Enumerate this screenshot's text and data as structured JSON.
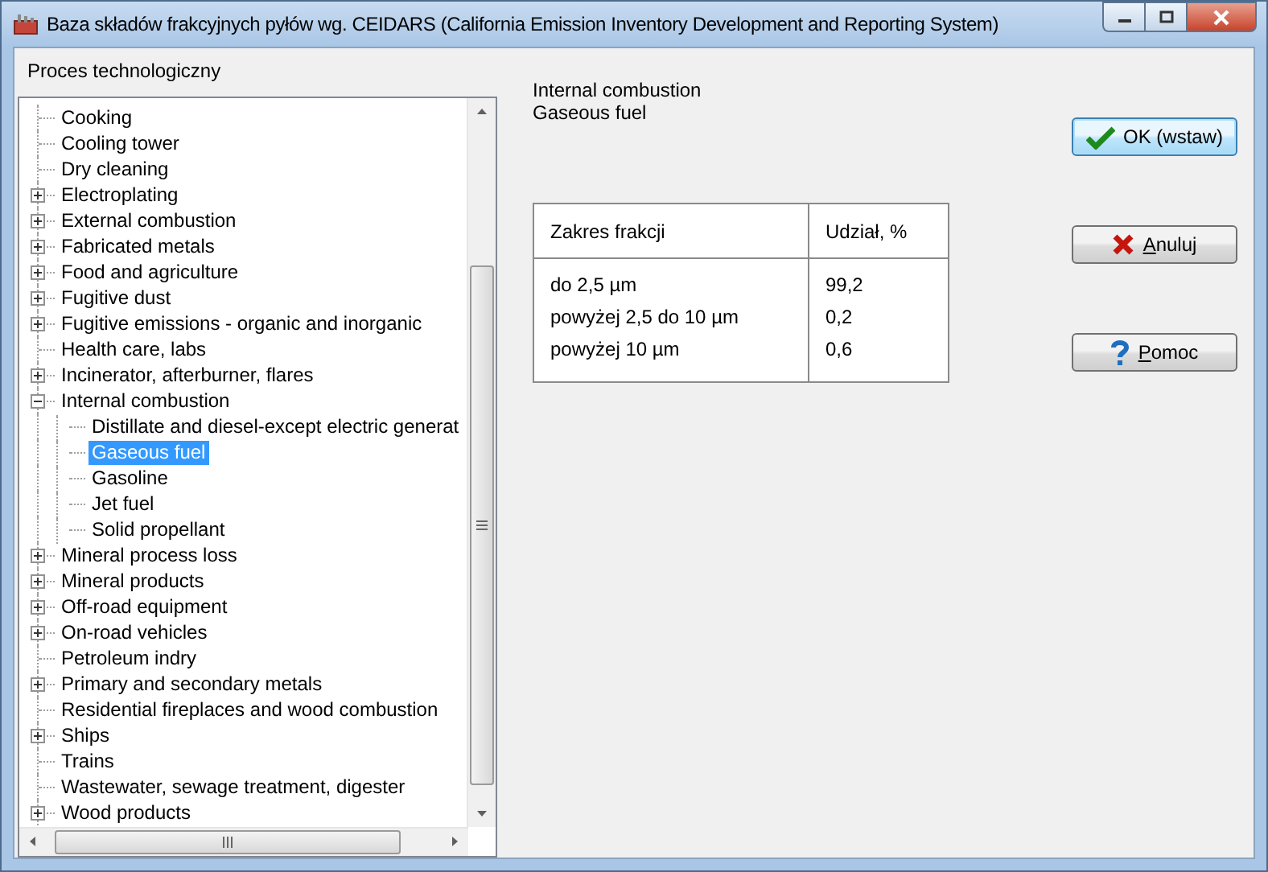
{
  "window": {
    "title": "Baza składów frakcyjnych pyłów wg. CEIDARS (California Emission Inventory Development and Reporting System)"
  },
  "tree": {
    "label": "Proces technologiczny",
    "items": [
      {
        "label": "Cooking",
        "selected": false
      },
      {
        "label": "Cooling tower",
        "selected": false
      },
      {
        "label": "Dry cleaning",
        "selected": false
      },
      {
        "label": "Electroplating",
        "expanded": false,
        "selected": false
      },
      {
        "label": "External combustion",
        "expanded": false,
        "selected": false
      },
      {
        "label": "Fabricated metals",
        "expanded": false,
        "selected": false
      },
      {
        "label": "Food and agriculture",
        "expanded": false,
        "selected": false
      },
      {
        "label": "Fugitive dust",
        "expanded": false,
        "selected": false
      },
      {
        "label": "Fugitive emissions - organic and inorganic",
        "expanded": false,
        "selected": false
      },
      {
        "label": "Health care, labs",
        "selected": false
      },
      {
        "label": "Incinerator, afterburner, flares",
        "expanded": false,
        "selected": false
      },
      {
        "label": "Internal combustion",
        "expanded": true,
        "selected": false,
        "children": [
          {
            "label": "Distillate and diesel-except electric generat",
            "selected": false
          },
          {
            "label": "Gaseous fuel",
            "selected": true
          },
          {
            "label": "Gasoline",
            "selected": false
          },
          {
            "label": "Jet fuel",
            "selected": false
          },
          {
            "label": "Solid propellant",
            "selected": false
          }
        ]
      },
      {
        "label": "Mineral process loss",
        "expanded": false,
        "selected": false
      },
      {
        "label": "Mineral products",
        "expanded": false,
        "selected": false
      },
      {
        "label": "Off-road equipment",
        "expanded": false,
        "selected": false
      },
      {
        "label": "On-road vehicles",
        "expanded": false,
        "selected": false
      },
      {
        "label": "Petroleum indry",
        "selected": false
      },
      {
        "label": "Primary and secondary metals",
        "expanded": false,
        "selected": false
      },
      {
        "label": "Residential fireplaces and wood combustion",
        "selected": false
      },
      {
        "label": "Ships",
        "expanded": false,
        "selected": false
      },
      {
        "label": "Trains",
        "selected": false
      },
      {
        "label": "Wastewater, sewage treatment, digester",
        "selected": false
      },
      {
        "label": "Wood products",
        "expanded": false,
        "selected": false
      }
    ]
  },
  "selection_path": [
    "Internal combustion",
    "Gaseous fuel"
  ],
  "table": {
    "columns": [
      "Zakres frakcji",
      "Udział, %"
    ],
    "rows": [
      [
        "do 2,5 µm",
        "99,2"
      ],
      [
        "powyżej 2,5 do 10 µm",
        "0,2"
      ],
      [
        "powyżej 10 µm",
        "0,6"
      ]
    ]
  },
  "buttons": [
    {
      "label": "OK (wstaw)",
      "kind": "ok",
      "default": true,
      "mnemonic": false
    },
    {
      "label": "Anuluj",
      "kind": "cancel",
      "default": false,
      "mnemonic": true
    },
    {
      "label": "Pomoc",
      "kind": "help",
      "default": false,
      "mnemonic": true
    }
  ]
}
